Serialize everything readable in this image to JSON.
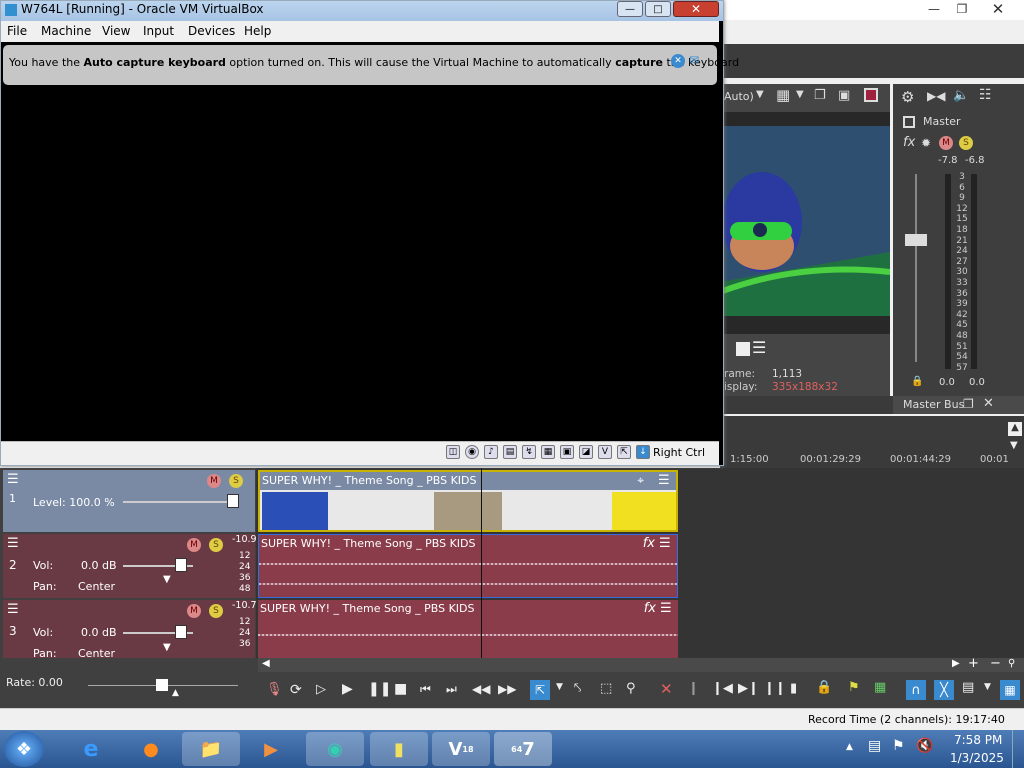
{
  "vbox": {
    "title": "W764L [Running] - Oracle VM VirtualBox",
    "menu": [
      "File",
      "Machine",
      "View",
      "Input",
      "Devices",
      "Help"
    ],
    "notice_parts": [
      "You have the ",
      "Auto capture keyboard",
      " option turned on. This will cause the Virtual Machine to automatically ",
      "capture",
      " the keyboard"
    ],
    "host_key": "Right Ctrl"
  },
  "vegas": {
    "preview_quality": "Auto)",
    "frame_label": "rame:",
    "frame_value": "1,113",
    "display_label": "isplay:",
    "display_value": "335x188x32",
    "master_label": "Master",
    "master_left_db": "-7.8",
    "master_right_db": "-6.8",
    "meter_scale": [
      "3",
      "6",
      "9",
      "12",
      "15",
      "18",
      "21",
      "24",
      "27",
      "30",
      "33",
      "36",
      "39",
      "42",
      "45",
      "48",
      "51",
      "54",
      "57"
    ],
    "master_left_level": "0.0",
    "master_right_level": "0.0",
    "master_bus_label": "Master Bus",
    "timecodes": [
      "1:15:00",
      "00:01:29:29",
      "00:01:44:29",
      "00:01"
    ],
    "tracks": [
      {
        "num": "1",
        "level_label": "Level: 100.0 %",
        "clip_title": "SUPER WHY! _ Theme Song _ PBS KIDS"
      },
      {
        "num": "2",
        "vol_label": "Vol:",
        "vol_value": "0.0 dB",
        "pan_label": "Pan:",
        "pan_value": "Center",
        "peak": "-10.9",
        "scale": [
          "12",
          "24",
          "36",
          "48"
        ],
        "clip_title": "SUPER WHY! _ Theme Song _ PBS KIDS"
      },
      {
        "num": "3",
        "vol_label": "Vol:",
        "vol_value": "0.0 dB",
        "pan_label": "Pan:",
        "pan_value": "Center",
        "peak": "-10.7",
        "scale": [
          "12",
          "24",
          "36"
        ],
        "clip_title": "SUPER WHY! _ Theme Song _ PBS KIDS"
      }
    ],
    "rate_label": "Rate: 0.00",
    "record_time": "Record Time (2 channels): 19:17:40"
  },
  "taskbar": {
    "time": "7:58 PM",
    "date": "1/3/2025",
    "vegas_badge": "18",
    "badge64": "64"
  },
  "colors": {
    "accent": "#3a6ae0",
    "audio_clip": "#8a3c4a",
    "video_track": "#7a8aa5"
  }
}
